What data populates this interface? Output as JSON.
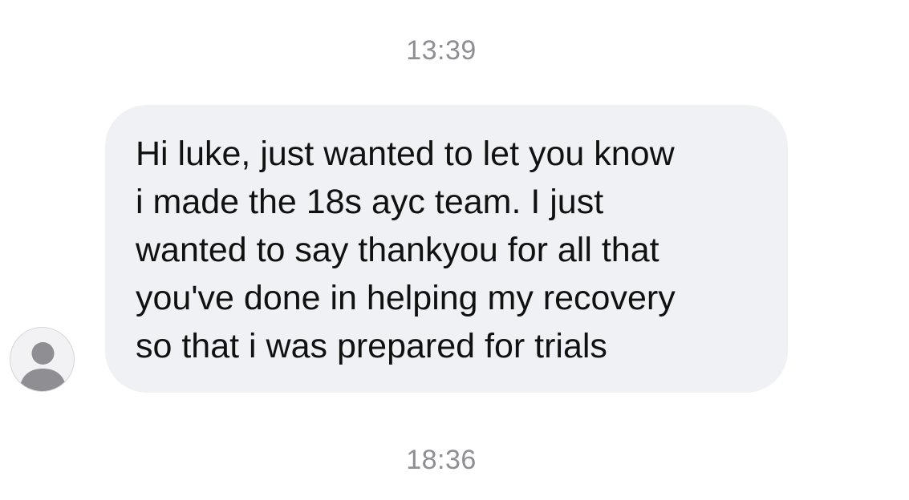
{
  "conversation": {
    "timestamps": [
      "13:39",
      "18:36"
    ],
    "message": {
      "sender_avatar_icon": "person-placeholder-icon",
      "text": "Hi luke, just wanted to let you know\ni made the 18s ayc team. I just\nwanted to say thankyou for all that\nyou've done in helping my recovery\nso that i was prepared for trials"
    }
  },
  "colors": {
    "background": "#ffffff",
    "bubble": "#f0f1f4",
    "timestamp": "#8e8e93",
    "avatar_figure": "#8e8e93"
  }
}
